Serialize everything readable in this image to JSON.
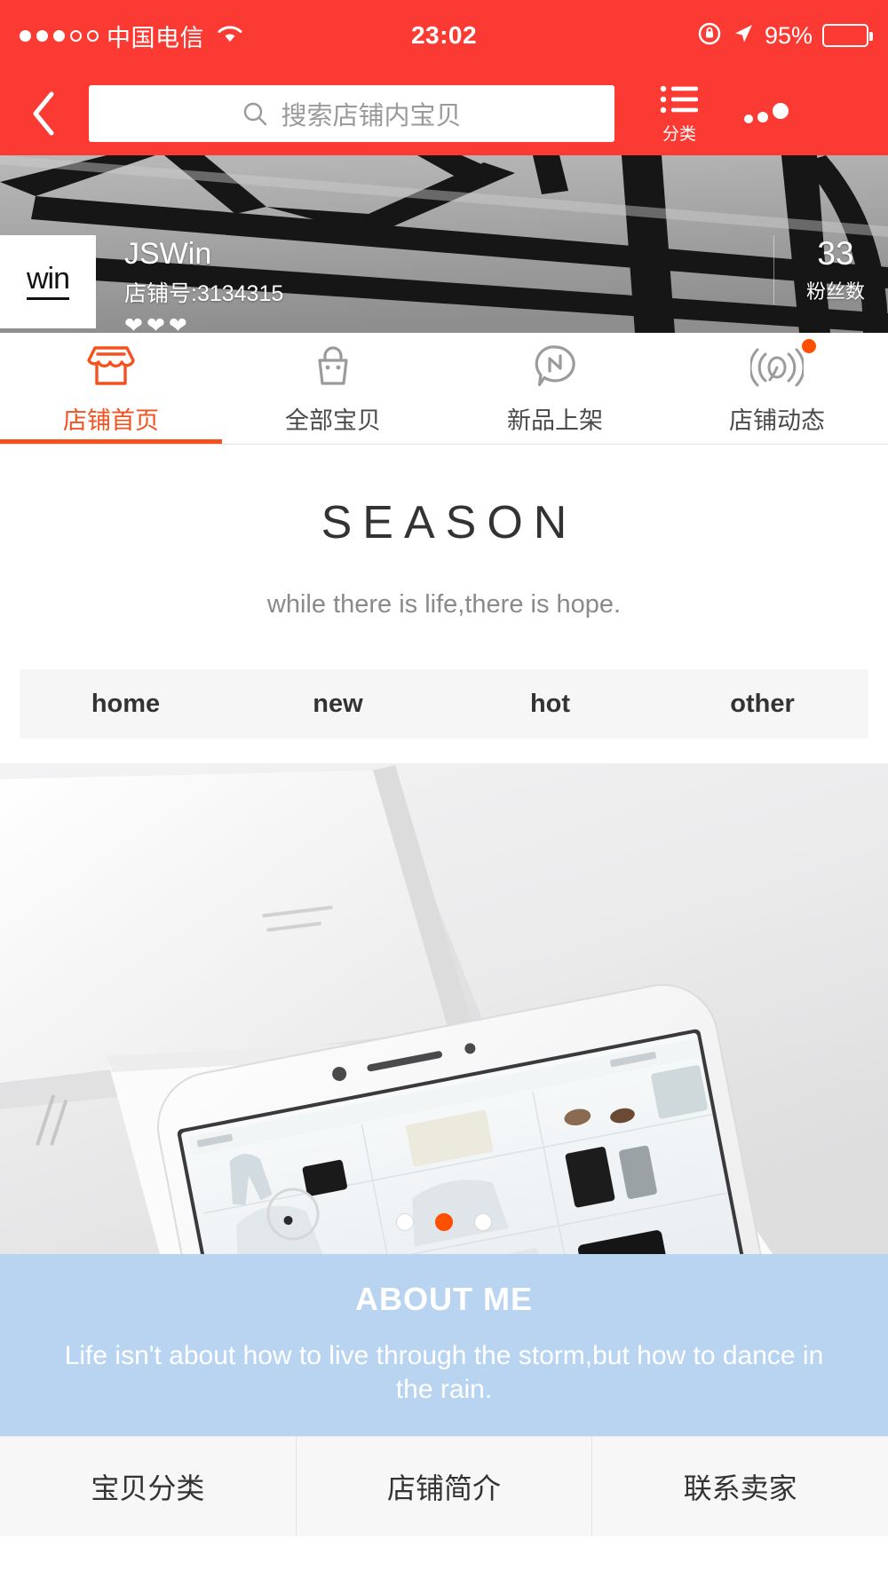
{
  "statusbar": {
    "carrier": "中国电信",
    "time": "23:02",
    "battery_pct": "95%",
    "signal_icon": "signal-dots-icon",
    "wifi_icon": "wifi-icon",
    "lock_icon": "rotation-lock-icon",
    "location_icon": "location-arrow-icon",
    "battery_icon": "battery-icon"
  },
  "navbar": {
    "back_icon": "back-chevron-icon",
    "search_placeholder": "搜索店铺内宝贝",
    "search_icon": "search-icon",
    "category_label": "分类",
    "category_icon": "list-icon",
    "more_icon": "more-dots-icon"
  },
  "shop": {
    "logo_text": "win",
    "name": "JSWin",
    "shop_id_label": "店铺号:3134315",
    "hearts": "❤❤❤",
    "fans_count": "33",
    "fans_label": "粉丝数"
  },
  "tabs": [
    {
      "label": "店铺首页",
      "icon": "storefront-icon",
      "active": true,
      "badge": false
    },
    {
      "label": "全部宝贝",
      "icon": "shopping-bag-icon",
      "active": false,
      "badge": false
    },
    {
      "label": "新品上架",
      "icon": "speech-bubble-n-icon",
      "active": false,
      "badge": false
    },
    {
      "label": "店铺动态",
      "icon": "broadcast-icon",
      "active": false,
      "badge": true
    }
  ],
  "season": {
    "title": "SEASON",
    "subtitle": "while there is life,there is hope."
  },
  "navrow": [
    {
      "label": "home"
    },
    {
      "label": "new"
    },
    {
      "label": "hot"
    },
    {
      "label": "other"
    }
  ],
  "carousel": {
    "dots_total": 3,
    "active_index": 1,
    "image_alt": "white-iphone-on-desk-photo"
  },
  "about": {
    "title": "ABOUT ME",
    "text": "Life isn't about how to live through the storm,but how to dance in the rain."
  },
  "bottom_links": [
    {
      "label": "宝贝分类"
    },
    {
      "label": "店铺简介"
    },
    {
      "label": "联系卖家"
    }
  ],
  "colors": {
    "brand_red": "#fb3b33",
    "accent_orange": "#f4511e",
    "dot_active": "#ff5000",
    "about_bg": "#b9d4f0"
  }
}
